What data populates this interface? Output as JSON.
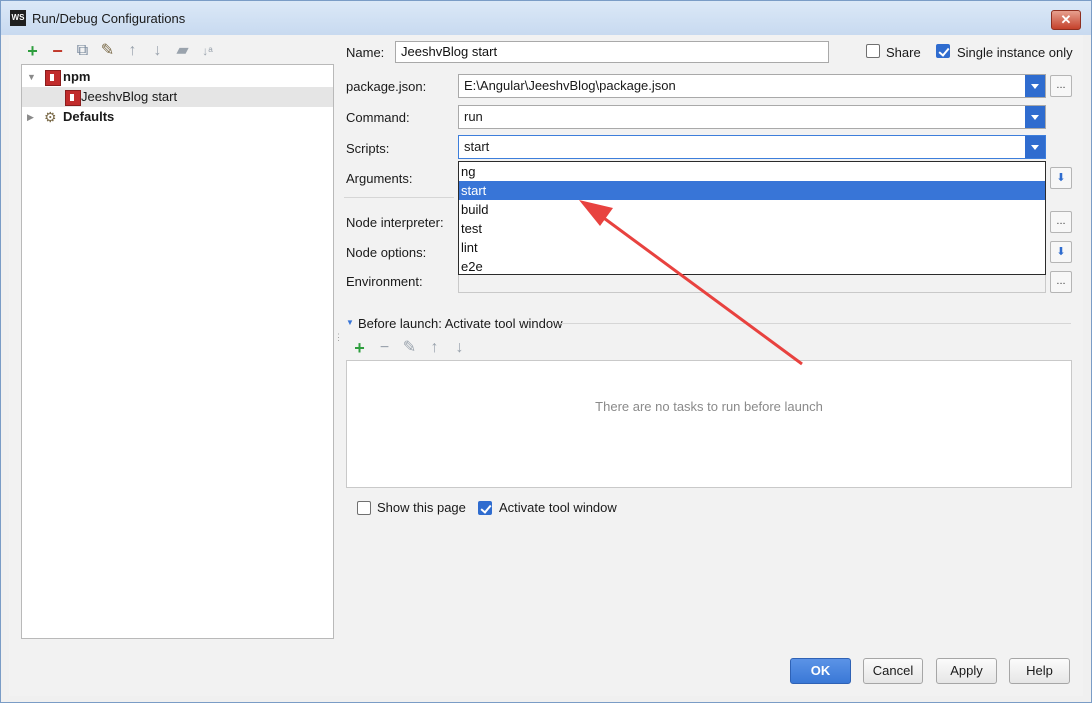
{
  "window": {
    "title": "Run/Debug Configurations",
    "app_icon": "WS"
  },
  "toolbar": {
    "add_icon": "+",
    "remove_icon": "−",
    "copy_icon": "⧉",
    "edit_icon": "✎",
    "up_icon": "↑",
    "down_icon": "↓",
    "folder_icon": "▰",
    "sort_icon": "↓ᵃ"
  },
  "tree": {
    "items": [
      {
        "label": "npm",
        "expanded": true
      },
      {
        "label": "JeeshvBlog start",
        "selected": true
      },
      {
        "label": "Defaults",
        "expanded": false
      }
    ]
  },
  "form": {
    "name_label": "Name:",
    "name_value": "JeeshvBlog start",
    "share_label": "Share",
    "share_checked": false,
    "single_instance_label": "Single instance only",
    "single_instance_checked": true,
    "package_json_label": "package.json:",
    "package_json_value": "E:\\Angular\\JeeshvBlog\\package.json",
    "command_label": "Command:",
    "command_value": "run",
    "scripts_label": "Scripts:",
    "scripts_value": "start",
    "arguments_label": "Arguments:",
    "node_interpreter_label": "Node interpreter:",
    "node_options_label": "Node options:",
    "environment_label": "Environment:",
    "dots": "..."
  },
  "dropdown": {
    "options": [
      "ng",
      "start",
      "build",
      "test",
      "lint",
      "e2e"
    ],
    "selected": "start"
  },
  "before_launch": {
    "header": "Before launch: Activate tool window",
    "empty_text": "There are no tasks to run before launch"
  },
  "options": {
    "show_page_label": "Show this page",
    "show_page_checked": false,
    "activate_tool_label": "Activate tool window",
    "activate_tool_checked": true
  },
  "buttons": {
    "ok": "OK",
    "cancel": "Cancel",
    "apply": "Apply",
    "help": "Help"
  },
  "colors": {
    "accent": "#3875d7",
    "arrow": "#e8423f"
  }
}
